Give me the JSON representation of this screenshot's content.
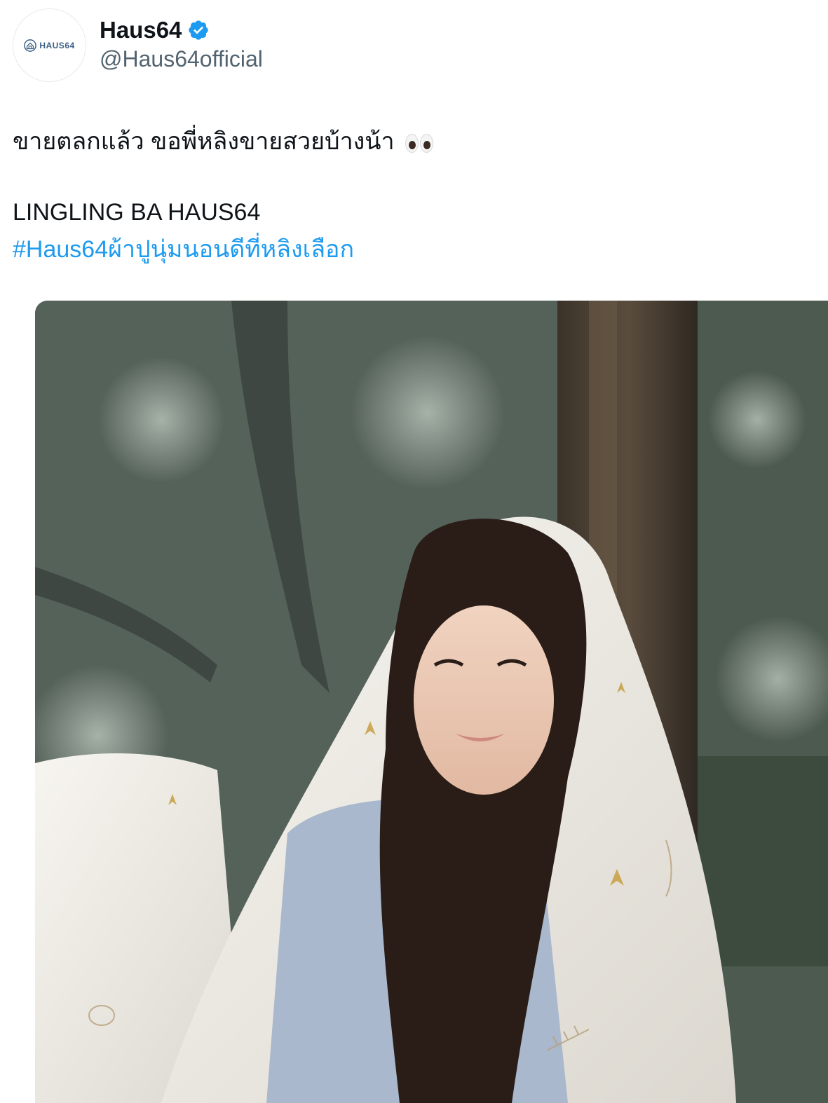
{
  "author": {
    "display_name": "Haus64",
    "handle": "@Haus64official",
    "verified": true,
    "avatar_logo_text": "HAUS64",
    "avatar_icon": "haus64-logo-icon",
    "verified_icon": "verified-badge-icon"
  },
  "tweet": {
    "text_line_1": "ขายตลกแล้ว ขอพี่หลิงขายสวยบ้างน้า",
    "emoji": "eyes-emoji",
    "text_line_2": "LINGLING BA HAUS64",
    "hashtag": "#Haus64ผ้าปูนุ่มนอนดีที่หลิงเลือก"
  },
  "media": {
    "type": "photo"
  },
  "colors": {
    "link": "#1d9bf0",
    "verified": "#1d9bf0",
    "handle": "#536471",
    "text": "#0f1419"
  }
}
